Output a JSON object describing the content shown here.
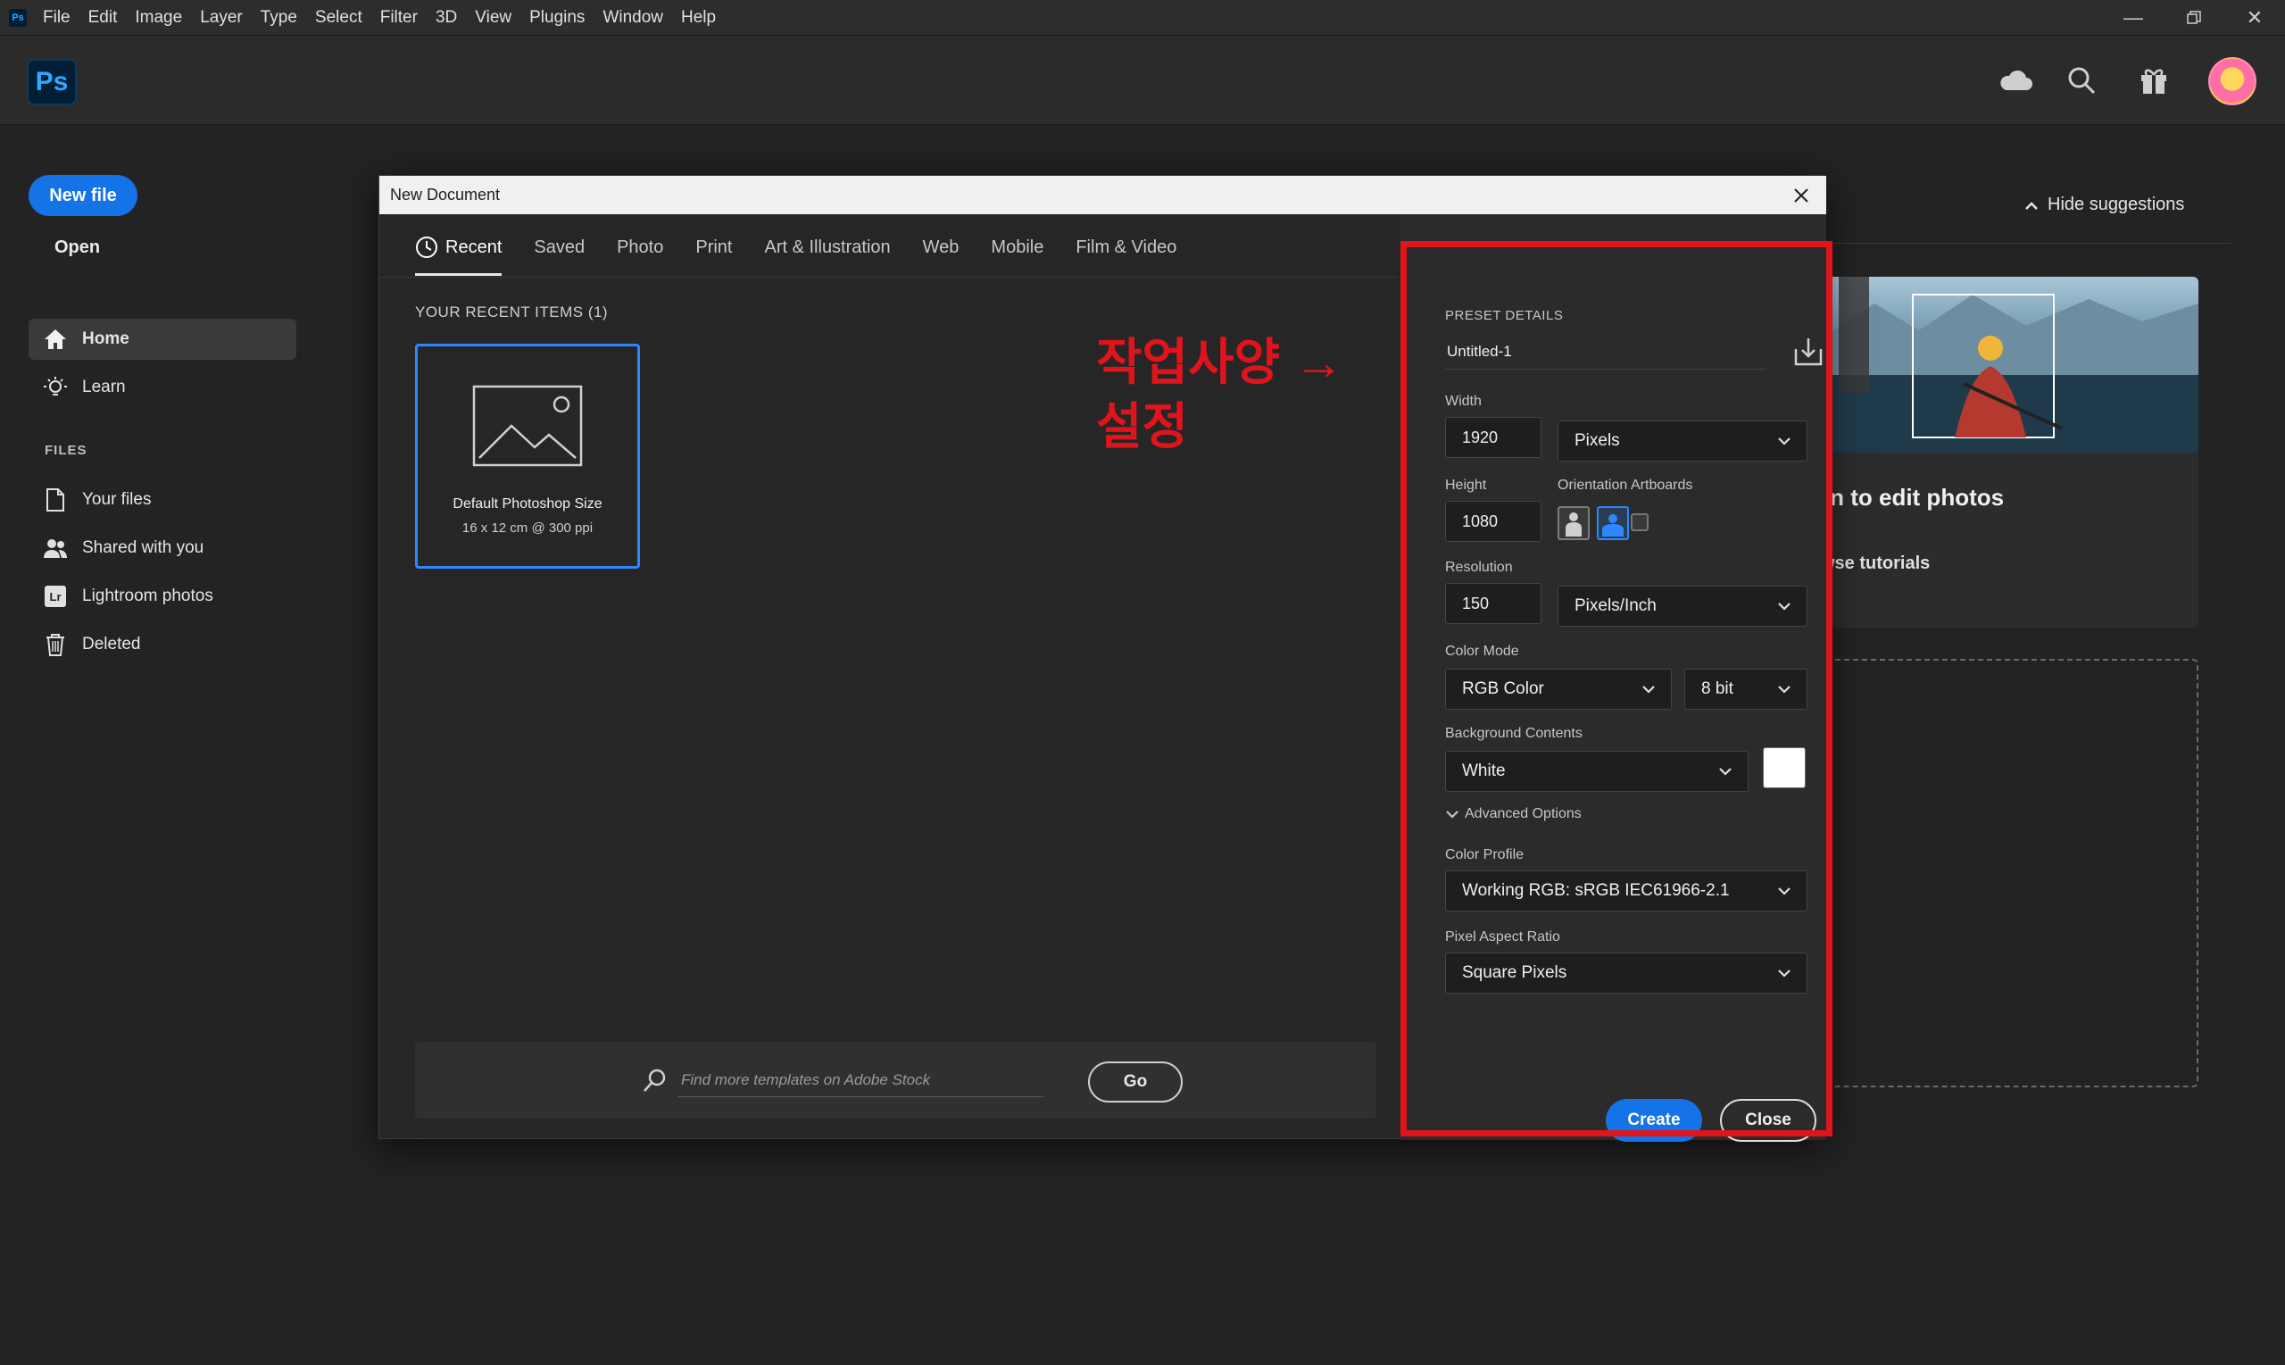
{
  "menubar": {
    "app_icon": "Ps",
    "items": [
      "File",
      "Edit",
      "Image",
      "Layer",
      "Type",
      "Select",
      "Filter",
      "3D",
      "View",
      "Plugins",
      "Window",
      "Help"
    ]
  },
  "appbar": {
    "logo": "Ps",
    "icons": [
      "cloud-icon",
      "search-icon",
      "gift-icon",
      "avatar"
    ]
  },
  "sidebar": {
    "new_file": "New file",
    "open": "Open",
    "nav": [
      {
        "label": "Home",
        "icon": "home-icon",
        "active": true
      },
      {
        "label": "Learn",
        "icon": "lightbulb-icon",
        "active": false
      }
    ],
    "files_heading": "FILES",
    "files": [
      {
        "label": "Your files",
        "icon": "file-icon"
      },
      {
        "label": "Shared with you",
        "icon": "users-icon"
      },
      {
        "label": "Lightroom photos",
        "icon": "lightroom-icon",
        "badge": "Lr"
      },
      {
        "label": "Deleted",
        "icon": "trash-icon"
      }
    ]
  },
  "suggestions": {
    "hide": "Hide suggestions",
    "card_title": "rn to edit photos",
    "card_link": "wse tutorials"
  },
  "dialog": {
    "title": "New Document",
    "tabs": [
      "Recent",
      "Saved",
      "Photo",
      "Print",
      "Art & Illustration",
      "Web",
      "Mobile",
      "Film & Video"
    ],
    "active_tab": "Recent",
    "recent_heading": "YOUR RECENT ITEMS  (1)",
    "recent_item": {
      "name": "Default Photoshop Size",
      "size": "16 x 12 cm @ 300 ppi"
    },
    "search": {
      "placeholder": "Find more templates on Adobe Stock",
      "go": "Go"
    },
    "annotation": [
      "작업사양 →",
      "설정"
    ],
    "annotation_color": "#e0141c",
    "preset": {
      "heading": "PRESET DETAILS",
      "name": "Untitled-1",
      "width_label": "Width",
      "width": "1920",
      "width_unit": "Pixels",
      "height_label": "Height",
      "height": "1080",
      "orientation_label": "Orientation",
      "artboards_label": "Artboards",
      "resolution_label": "Resolution",
      "resolution": "150",
      "resolution_unit": "Pixels/Inch",
      "color_mode_label": "Color Mode",
      "color_mode": "RGB Color",
      "bit_depth": "8 bit",
      "bg_label": "Background Contents",
      "bg": "White",
      "bg_swatch": "#ffffff",
      "advanced": "Advanced Options",
      "profile_label": "Color Profile",
      "profile": "Working RGB: sRGB IEC61966-2.1",
      "aspect_label": "Pixel Aspect Ratio",
      "aspect": "Square Pixels",
      "create": "Create",
      "close": "Close"
    }
  },
  "colors": {
    "accent": "#1473e6",
    "selection": "#2d87ff",
    "highlight": "#e0141c"
  }
}
